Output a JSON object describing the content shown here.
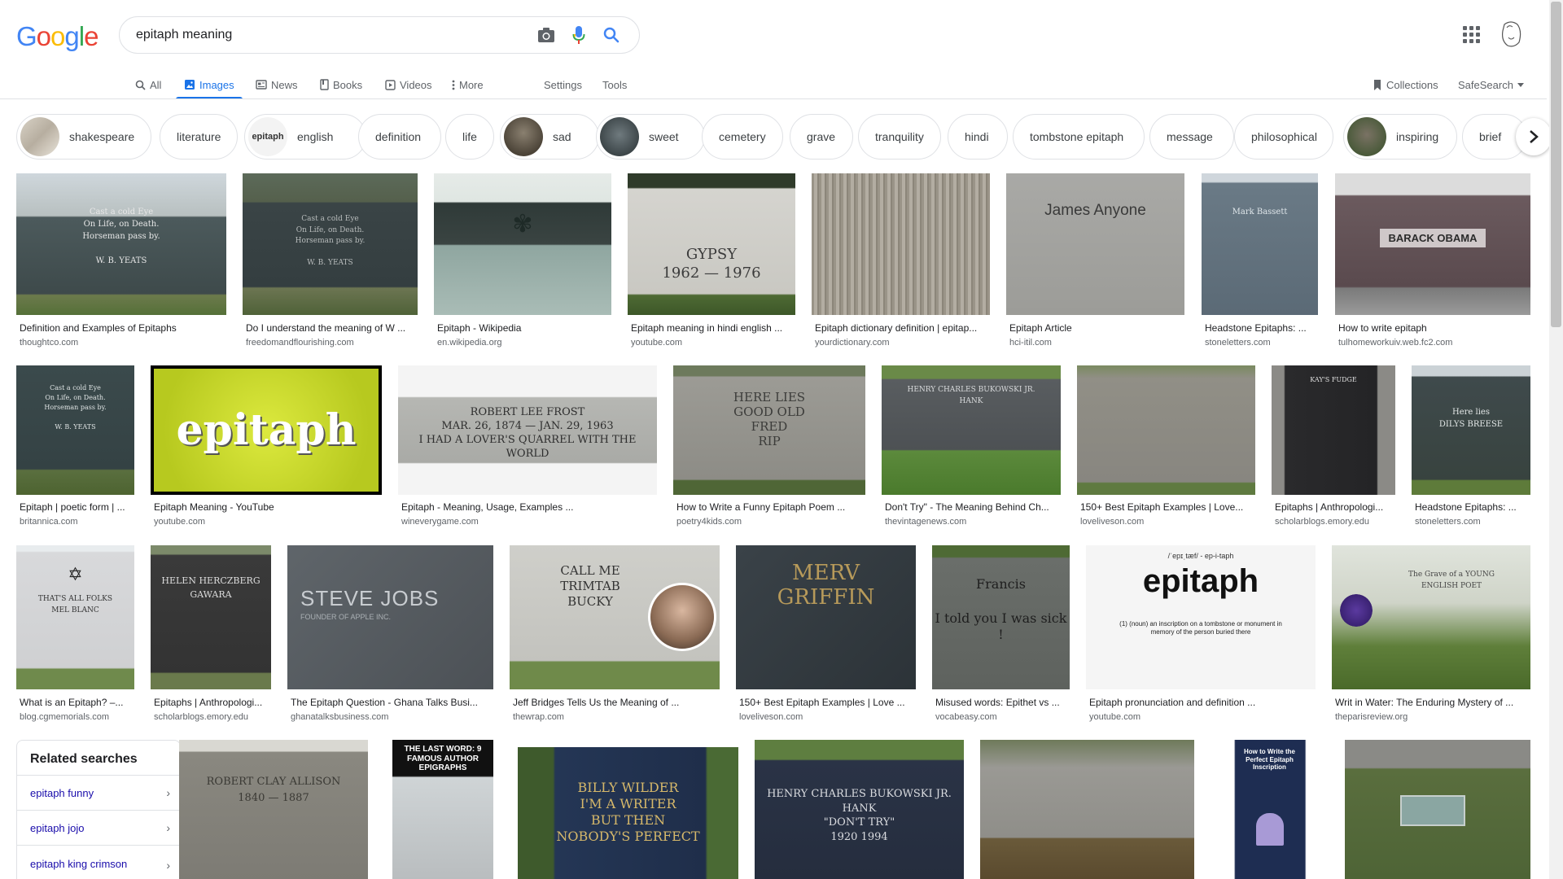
{
  "search": {
    "query": "epitaph meaning"
  },
  "logo_letters": [
    "G",
    "o",
    "o",
    "g",
    "l",
    "e"
  ],
  "colors": {
    "blue": "#4285f4",
    "red": "#ea4335",
    "yellow": "#fbbc05",
    "green": "#34a853",
    "accent": "#1a73e8"
  },
  "tabs": {
    "all": "All",
    "images": "Images",
    "news": "News",
    "books": "Books",
    "videos": "Videos",
    "more": "More",
    "settings": "Settings",
    "tools": "Tools",
    "collections": "Collections",
    "safesearch": "SafeSearch"
  },
  "chips": [
    "shakespeare",
    "literature",
    "english",
    "definition",
    "life",
    "sad",
    "sweet",
    "cemetery",
    "grave",
    "tranquility",
    "hindi",
    "tombstone epitaph",
    "message",
    "philosophical",
    "inspiring",
    "brief"
  ],
  "chip_image_text": {
    "english": "epitaph"
  },
  "results": [
    {
      "title": "Definition and Examples of Epitaphs",
      "source": "thoughtco.com"
    },
    {
      "title": "Do I understand the meaning of W ...",
      "source": "freedomandflourishing.com"
    },
    {
      "title": "Epitaph - Wikipedia",
      "source": "en.wikipedia.org"
    },
    {
      "title": "Epitaph meaning in hindi english ...",
      "source": "youtube.com"
    },
    {
      "title": "Epitaph dictionary definition | epitap...",
      "source": "yourdictionary.com"
    },
    {
      "title": "Epitaph Article",
      "source": "hci-itil.com"
    },
    {
      "title": "Headstone Epitaphs: ...",
      "source": "stoneletters.com"
    },
    {
      "title": "How to write epitaph",
      "source": "tulhomeworkuiv.web.fc2.com"
    },
    {
      "title": "Epitaph | poetic form | ...",
      "source": "britannica.com"
    },
    {
      "title": "Epitaph Meaning - YouTube",
      "source": "youtube.com"
    },
    {
      "title": "Epitaph - Meaning, Usage, Examples ...",
      "source": "wineverygame.com"
    },
    {
      "title": "How to Write a Funny Epitaph Poem ...",
      "source": "poetry4kids.com"
    },
    {
      "title": "Don't Try\" - The Meaning Behind Ch...",
      "source": "thevintagenews.com"
    },
    {
      "title": "150+ Best Epitaph Examples | Love...",
      "source": "loveliveson.com"
    },
    {
      "title": "Epitaphs | Anthropologi...",
      "source": "scholarblogs.emory.edu"
    },
    {
      "title": "Headstone Epitaphs: ...",
      "source": "stoneletters.com"
    },
    {
      "title": "What is an Epitaph? –...",
      "source": "blog.cgmemorials.com"
    },
    {
      "title": "Epitaphs | Anthropologi...",
      "source": "scholarblogs.emory.edu"
    },
    {
      "title": "The Epitaph Question - Ghana Talks Busi...",
      "source": "ghanatalksbusiness.com"
    },
    {
      "title": "Jeff Bridges Tells Us the Meaning of ...",
      "source": "thewrap.com"
    },
    {
      "title": "150+ Best Epitaph Examples | Love ...",
      "source": "loveliveson.com"
    },
    {
      "title": "Misused words: Epithet vs ...",
      "source": "vocabeasy.com"
    },
    {
      "title": "Epitaph pronunciation and definition ...",
      "source": "youtube.com"
    },
    {
      "title": "Writ in Water: The Enduring Mystery of ...",
      "source": "theparisreview.org"
    }
  ],
  "image_text": {
    "yeats": "Cast a cold Eye\nOn Life, on Death.\nHorseman pass by.\n\nW. B. YEATS",
    "gypsy": "GYPSY\n1962 — 1976",
    "james_anyone": "James Anyone",
    "mark_bassett": "Mark Bassett",
    "obama": "BARACK OBAMA",
    "epitaph_word": "epitaph",
    "frost": "ROBERT LEE FROST\nMAR. 26, 1874 — JAN. 29, 1963\nI HAD A LOVER'S QUARREL WITH THE WORLD",
    "fred": "HERE LIES\nGOOD OLD\nFRED\nRIP",
    "bukowski": "HENRY CHARLES BUKOWSKI JR.\nHANK",
    "kays_fudge": "KAY'S FUDGE",
    "dilys": "Here lies\nDILYS BREESE",
    "mel_blanc": "THAT'S ALL FOLKS\nMEL BLANC",
    "helen": "HELEN HERCZBERG\nGAWARA",
    "jobs": "STEVE JOBS",
    "jobs_sub": "FOUNDER OF APPLE INC.",
    "trimtab": "CALL ME\nTRIMTAB\nBUCKY",
    "merv": "MERV\nGRIFFIN",
    "francis": "Francis\n\nI told you I was sick !",
    "pron": "/ˈepɪˌtæf/ - ep-i-taph",
    "pron_word": "epitaph",
    "pron_def": "(1) (noun) an inscription on a tombstone or monument in memory of the person buried there",
    "young_poet": "The Grave of a YOUNG ENGLISH POET",
    "allison": "ROBERT CLAY ALLISON\n1840 — 1887",
    "last_word": "THE LAST WORD: 9 FAMOUS AUTHOR EPIGRAPHS",
    "wilder": "BILLY WILDER\nI'M A WRITER\nBUT THEN\nNOBODY'S PERFECT",
    "bukowski2": "HENRY CHARLES BUKOWSKI JR.\nHANK\n\"DON'T TRY\"\n1920   1994",
    "perfect": "How to Write the Perfect Epitaph Inscription"
  },
  "related": {
    "title": "Related searches",
    "items": [
      "epitaph funny",
      "epitaph jojo",
      "epitaph king crimson"
    ]
  }
}
